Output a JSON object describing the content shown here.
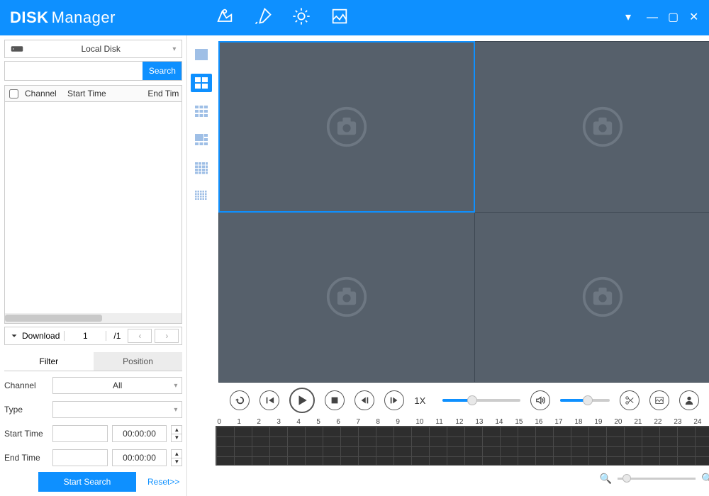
{
  "brand": {
    "part1": "DISK",
    "part2": "Manager"
  },
  "sidebar": {
    "disk_label": "Local Disk",
    "search_button": "Search",
    "table": {
      "col_channel": "Channel",
      "col_start": "Start Time",
      "col_end": "End Tim"
    },
    "download_label": "Download",
    "page_current": "1",
    "page_total": "/1",
    "tabs": {
      "filter": "Filter",
      "position": "Position"
    },
    "form": {
      "channel_label": "Channel",
      "channel_value": "All",
      "type_label": "Type",
      "type_value": "",
      "start_label": "Start Time",
      "start_time": "00:00:00",
      "end_label": "End Time",
      "end_time": "00:00:00",
      "search_button": "Start Search",
      "reset": "Reset>>"
    }
  },
  "playback": {
    "speed": "1X"
  },
  "timeline": {
    "hours": [
      "0",
      "1",
      "2",
      "3",
      "4",
      "5",
      "6",
      "7",
      "8",
      "9",
      "10",
      "11",
      "12",
      "13",
      "14",
      "15",
      "16",
      "17",
      "18",
      "19",
      "20",
      "21",
      "22",
      "23",
      "24"
    ]
  }
}
